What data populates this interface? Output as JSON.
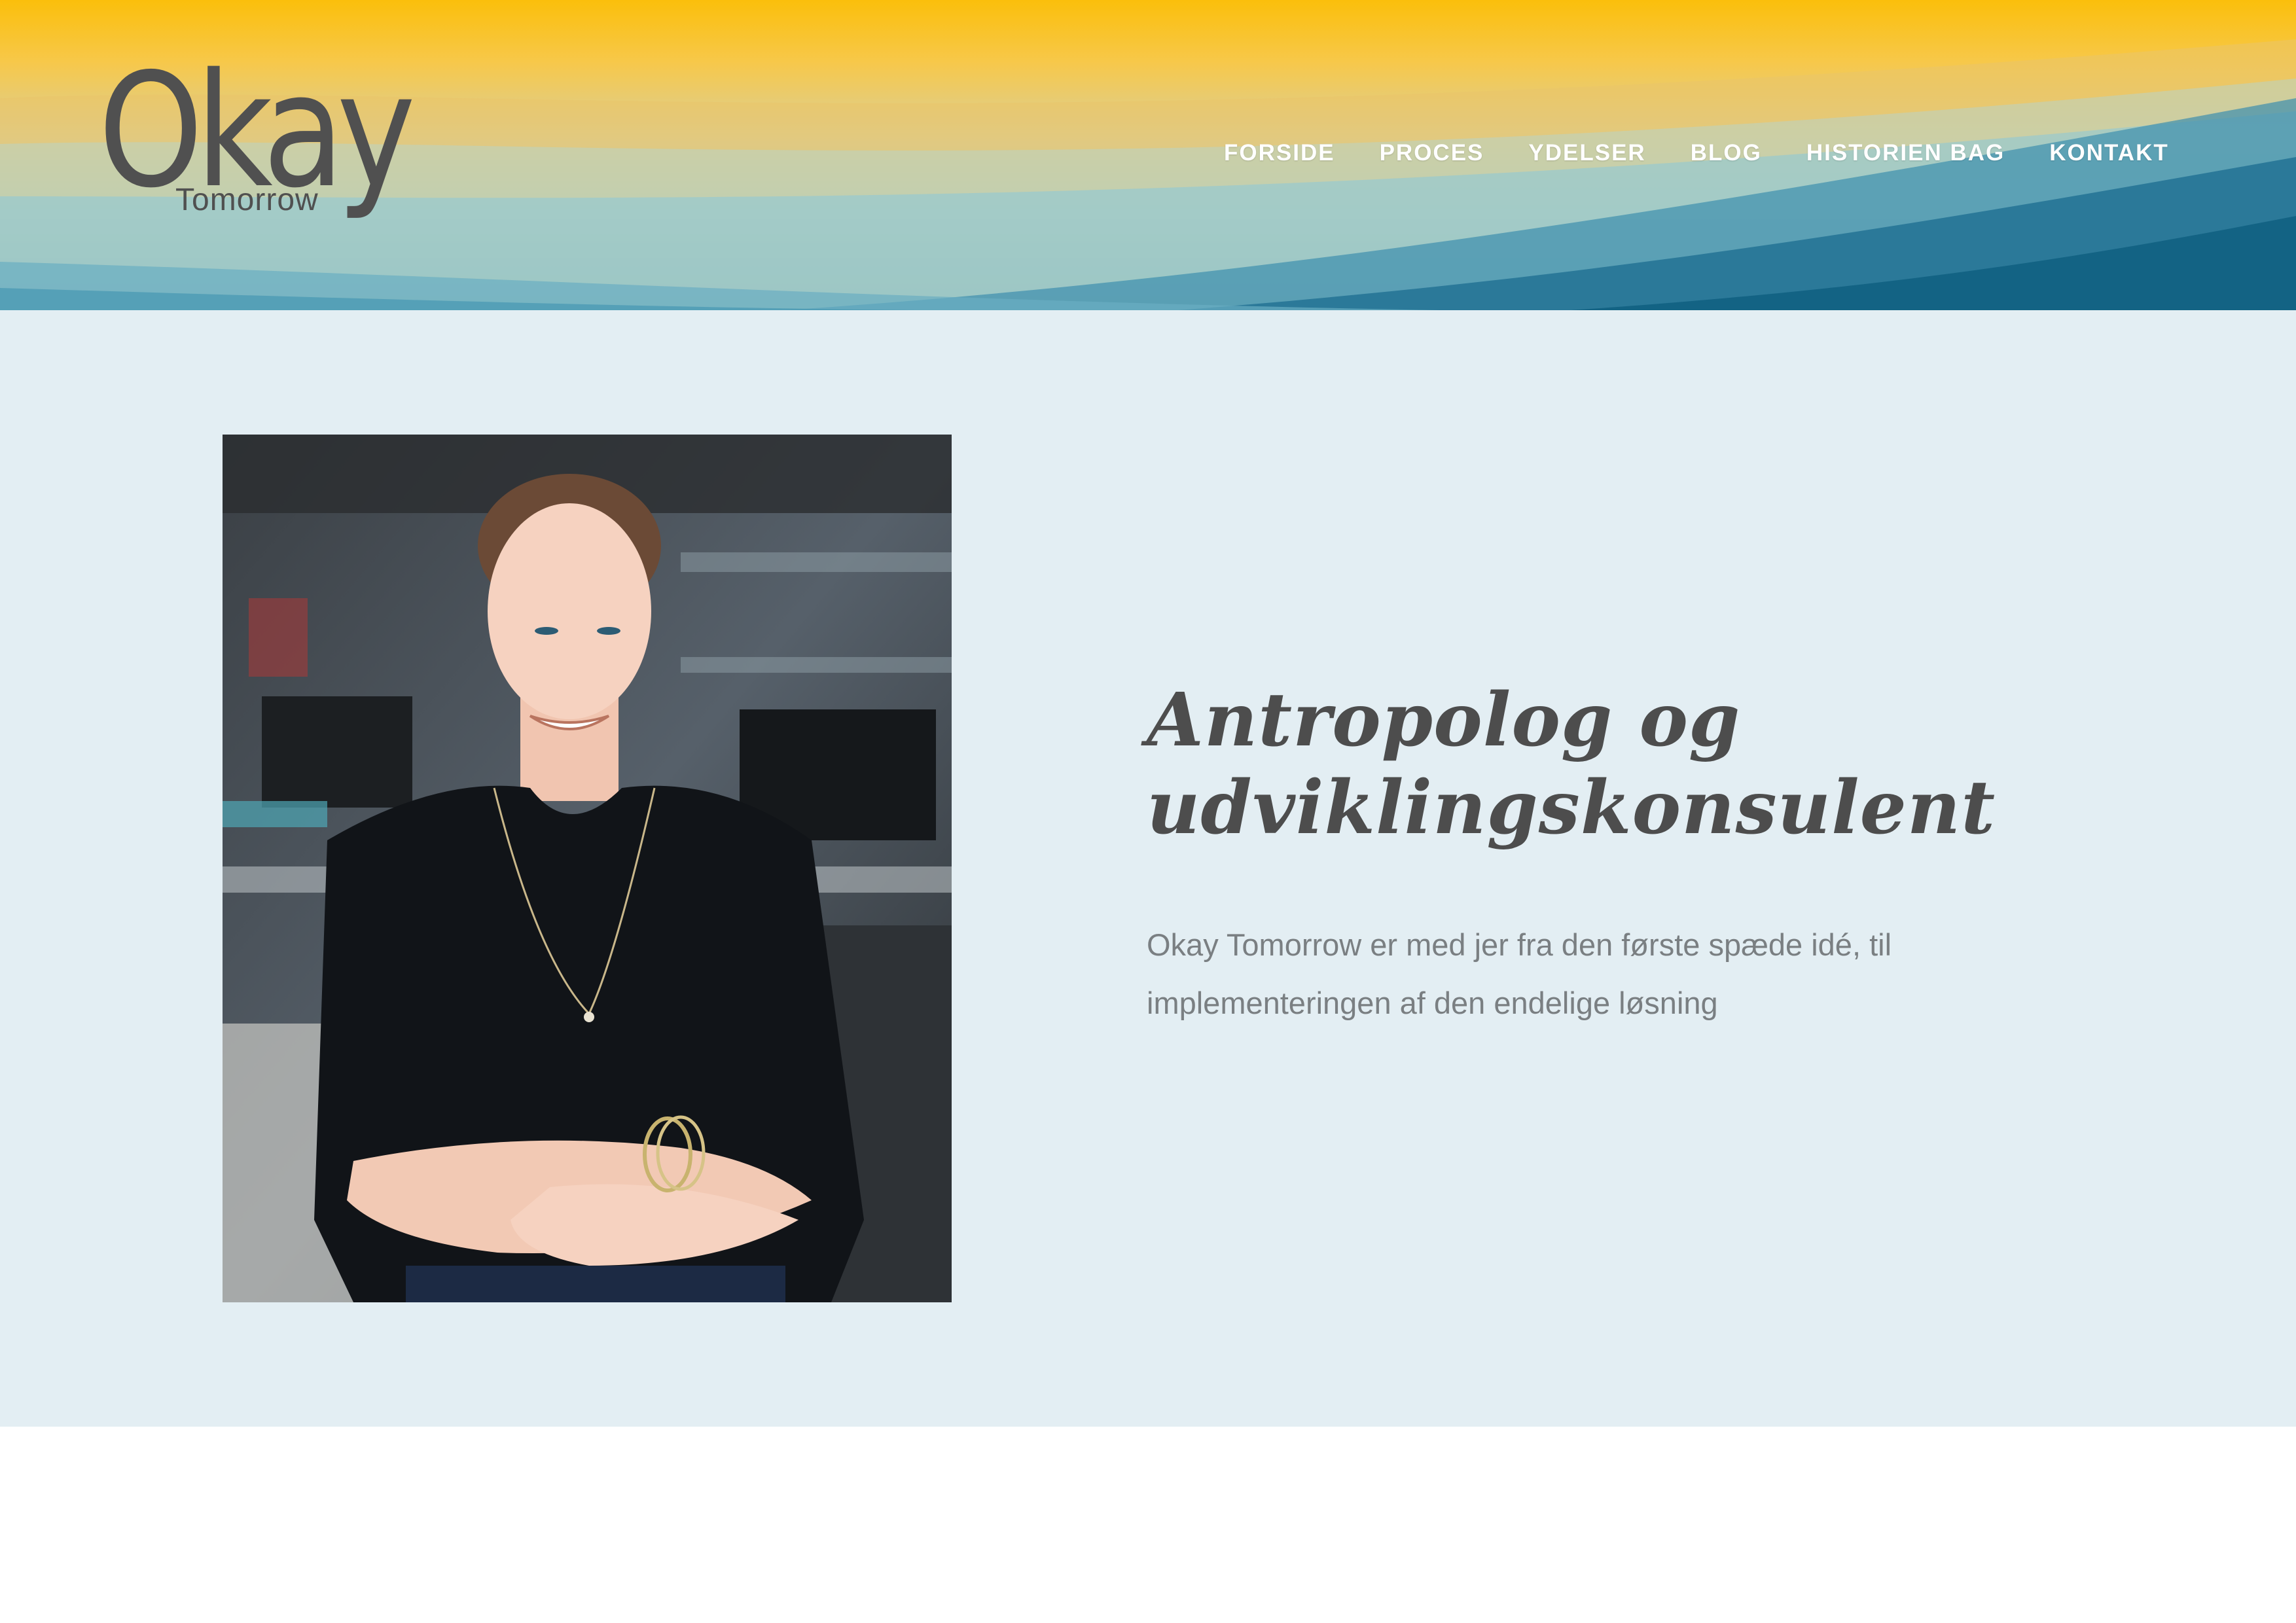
{
  "brand": {
    "logo_main": "Okay",
    "logo_sub": "Tomorrow"
  },
  "nav": {
    "items": [
      {
        "label": "FORSIDE"
      },
      {
        "label": "PROCES"
      },
      {
        "label": "YDELSER"
      },
      {
        "label": "BLOG"
      },
      {
        "label": "HISTORIEN BAG"
      },
      {
        "label": "KONTAKT"
      }
    ]
  },
  "hero": {
    "title": "Antropolog og udviklingskonsulent",
    "description": "Okay Tomorrow er med jer fra den første spæde idé, til implementeringen af den endelige løsning"
  },
  "colors": {
    "header_yellow": "#fbbf0b",
    "header_teal": "#0f6a8a",
    "hero_background": "#e3eef3",
    "heading_text": "#4d4d4d",
    "body_text": "#7a7f82",
    "nav_text": "#ffffff"
  }
}
